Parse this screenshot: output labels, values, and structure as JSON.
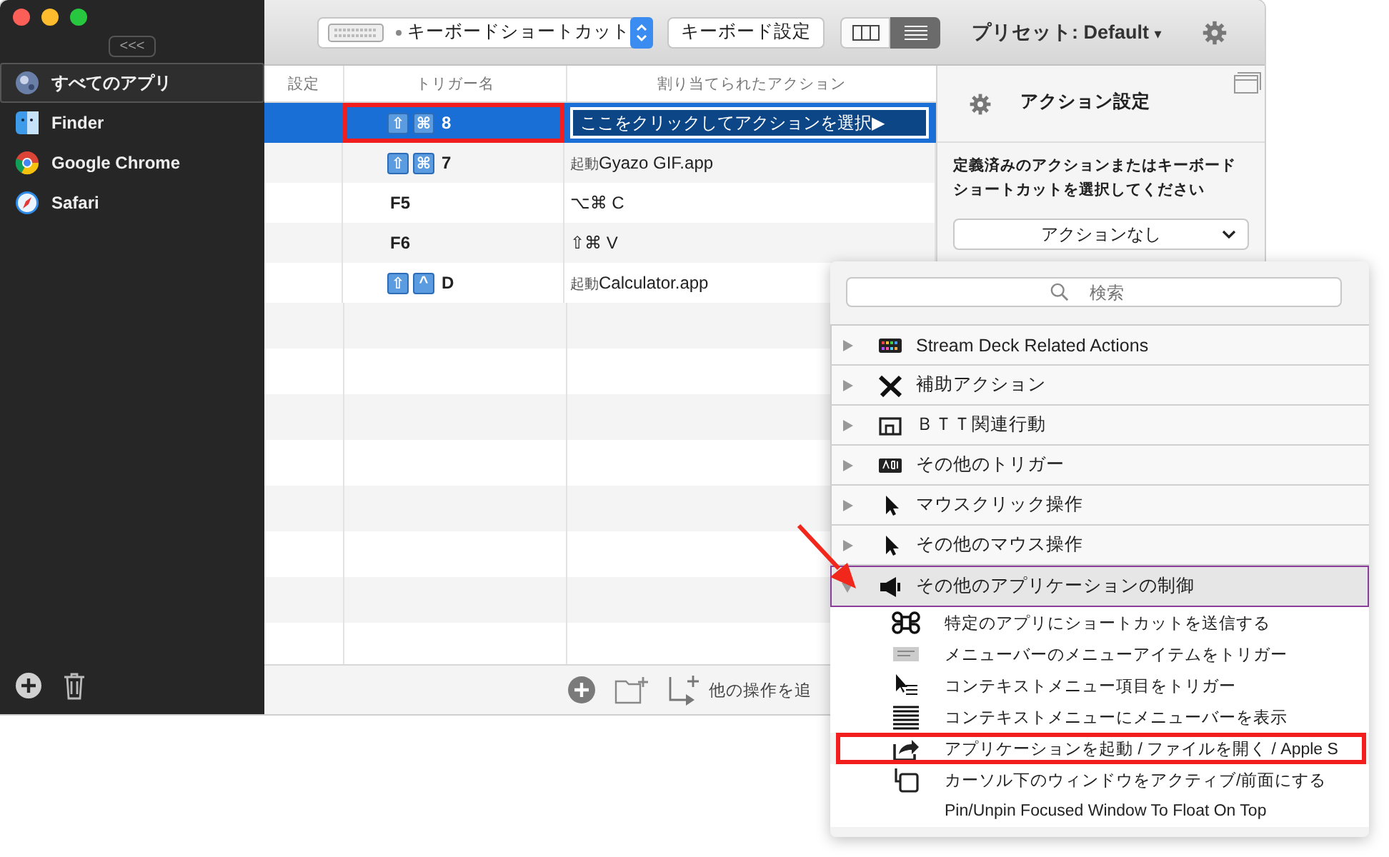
{
  "sidebar": {
    "collapse_button": "<<<",
    "apps": [
      {
        "name": "すべてのアプリ",
        "selected": true
      },
      {
        "name": "Finder",
        "selected": false
      },
      {
        "name": "Google Chrome",
        "selected": false
      },
      {
        "name": "Safari",
        "selected": false
      }
    ]
  },
  "toolbar": {
    "trigger_type": "キーボードショートカット",
    "settings_button": "キーボード設定",
    "views": [
      {
        "selected": false
      },
      {
        "selected": true
      }
    ],
    "preset": "プリセット: Default",
    "preset_caret": "▾"
  },
  "table": {
    "columns": [
      "設定",
      "トリガー名",
      "割り当てられたアクション"
    ],
    "rows": [
      {
        "keys": [
          "⇧",
          "⌘"
        ],
        "trigger": "8",
        "action_prefix": "",
        "action": "ここをクリックしてアクションを選択▶",
        "selected": true,
        "highlighted": true
      },
      {
        "keys": [
          "⇧",
          "⌘"
        ],
        "trigger": "7",
        "action_prefix": "起動",
        "action": "Gyazo GIF.app",
        "selected": false,
        "highlighted": false
      },
      {
        "keys": [],
        "trigger": "F5",
        "action_prefix": "",
        "action": "⌥⌘ C",
        "selected": false,
        "highlighted": false
      },
      {
        "keys": [],
        "trigger": "F6",
        "action_prefix": "",
        "action": "⇧⌘ V",
        "selected": false,
        "highlighted": false
      },
      {
        "keys": [
          "⇧",
          "^"
        ],
        "trigger": "D",
        "action_prefix": "起動",
        "action": "Calculator.app",
        "selected": false,
        "highlighted": false
      }
    ]
  },
  "bottom_bar": {
    "add_label": "他の操作を追"
  },
  "action_panel": {
    "title": "アクション設定",
    "description": "定義済みのアクションまたはキーボードショートカットを選択してください",
    "dropdown": "アクションなし"
  },
  "popup": {
    "search": {
      "placeholder": "検索"
    },
    "groups": [
      {
        "label": "Stream Deck Related Actions",
        "expanded": false
      },
      {
        "label": "補助アクション",
        "expanded": false
      },
      {
        "label": "ＢＴＴ関連行動",
        "expanded": false
      },
      {
        "label": "その他のトリガー",
        "expanded": false
      },
      {
        "label": "マウスクリック操作",
        "expanded": false
      },
      {
        "label": "その他のマウス操作",
        "expanded": false
      },
      {
        "label": "その他のアプリケーションの制御",
        "expanded": true,
        "pointed": true,
        "children": [
          {
            "label": "特定のアプリにショートカットを送信する",
            "highlighted": false
          },
          {
            "label": "メニューバーのメニューアイテムをトリガー",
            "highlighted": false
          },
          {
            "label": "コンテキストメニュー項目をトリガー",
            "highlighted": false
          },
          {
            "label": "コンテキストメニューにメニューバーを表示",
            "highlighted": false
          },
          {
            "label": "アプリケーションを起動 / ファイルを開く / Apple S",
            "highlighted": true
          },
          {
            "label": "カーソル下のウィンドウをアクティブ/前面にする",
            "highlighted": false
          },
          {
            "label": "Pin/Unpin Focused Window To Float On Top",
            "highlighted": false
          }
        ]
      }
    ]
  }
}
